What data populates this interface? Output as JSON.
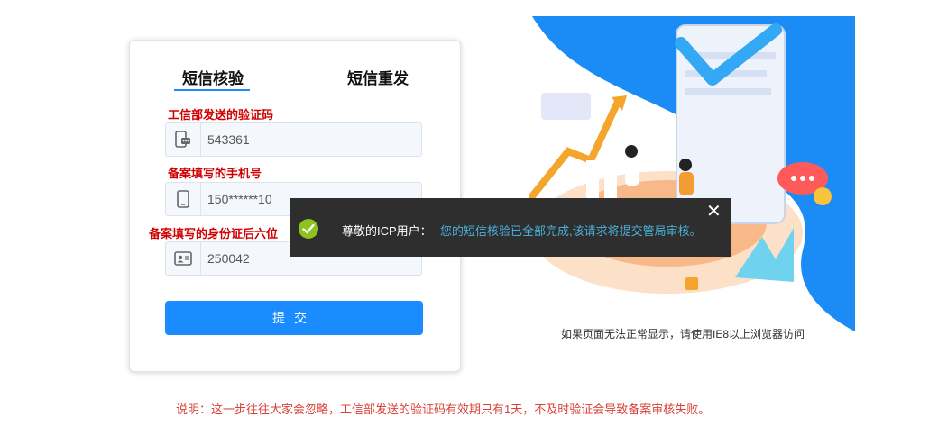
{
  "tabs": [
    {
      "label": "短信核验",
      "active": true
    },
    {
      "label": "短信重发",
      "active": false
    }
  ],
  "form": {
    "code_label": "工信部发送的验证码",
    "code_value": "543361",
    "code_icon": "sms-phone-icon",
    "phone_label": "备案填写的手机号",
    "phone_value": "150******10",
    "phone_icon": "mobile-phone-icon",
    "id_label": "备案填写的身份证后六位",
    "id_value": "250042",
    "id_icon": "id-card-icon",
    "submit_label": "提交"
  },
  "toast": {
    "title": "尊敬的ICP用户：",
    "message": "您的短信核验已全部完成,该请求将提交管局审核。",
    "close": "✕",
    "icon": "success-check-icon"
  },
  "illustration": {
    "browser_tip": "如果页面无法正常显示，请使用IE8以上浏览器访问"
  },
  "footer": {
    "note": "说明：这一步往往大家会忽略，工信部发送的验证码有效期只有1天，不及时验证会导致备案审核失败。"
  },
  "colors": {
    "accent": "#1a8cff",
    "label_red": "#d00000",
    "note_red": "#d9423a",
    "toast_bg": "#2e2e2e",
    "toast_text": "#4bb0d8",
    "success_green": "#8dc21f"
  }
}
